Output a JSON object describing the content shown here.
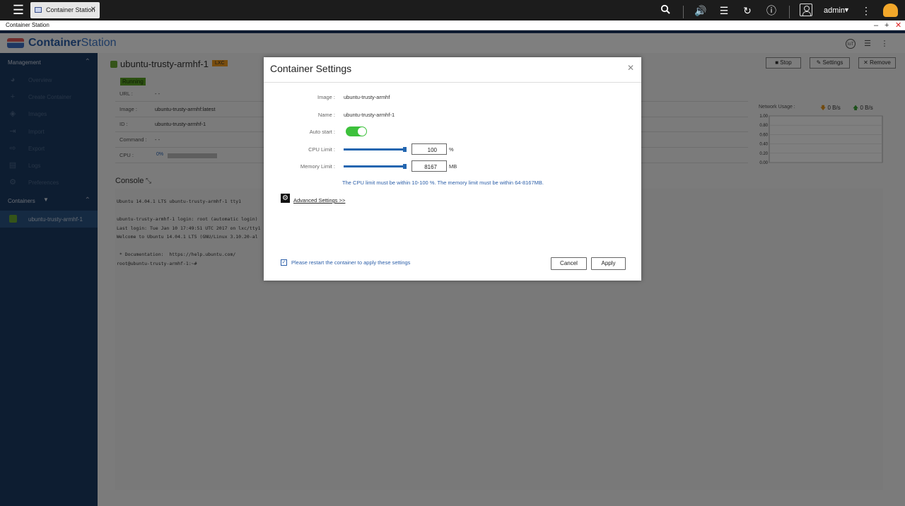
{
  "topbar": {
    "tab_label": "Container Station",
    "user": "admin"
  },
  "window": {
    "title": "Container Station"
  },
  "header": {
    "logo_bold": "Container",
    "logo_light": "Station"
  },
  "sidebar": {
    "management_label": "Management",
    "items": [
      {
        "label": "Overview",
        "icon": "gauge-icon"
      },
      {
        "label": "Create Container",
        "icon": "plus-icon"
      },
      {
        "label": "Images",
        "icon": "layers-icon"
      },
      {
        "label": "Import",
        "icon": "import-icon"
      },
      {
        "label": "Export",
        "icon": "export-icon"
      },
      {
        "label": "Logs",
        "icon": "logs-icon"
      },
      {
        "label": "Preferences",
        "icon": "gear-icon"
      }
    ],
    "containers_label": "Containers",
    "active_container": "ubuntu-trusty-armhf-1"
  },
  "container": {
    "name": "ubuntu-trusty-armhf-1",
    "type_badge": "LXC",
    "status": "Running",
    "details": [
      {
        "key": "URL :",
        "value": "- -"
      },
      {
        "key": "Image :",
        "value": "ubuntu-trusty-armhf:latest"
      },
      {
        "key": "ID :",
        "value": "ubuntu-trusty-armhf-1"
      },
      {
        "key": "Command :",
        "value": "- -"
      },
      {
        "key": "CPU :",
        "value": ""
      }
    ],
    "cpu_percent": "0%",
    "actions": {
      "stop": "Stop",
      "settings": "Settings",
      "remove": "Remove"
    }
  },
  "network": {
    "label": "Network Usage :",
    "download": "0 B/s",
    "upload": "0 B/s"
  },
  "chart_data": {
    "type": "line",
    "title": "",
    "ylim": [
      0,
      1
    ],
    "yticks": [
      "1.00",
      "0.80",
      "0.60",
      "0.40",
      "0.20",
      "0.00"
    ],
    "series": []
  },
  "console": {
    "title": "Console",
    "lines": [
      "Ubuntu 14.04.1 LTS ubuntu-trusty-armhf-1 tty1",
      "",
      "ubuntu-trusty-armhf-1 login: root (automatic login)",
      "Last login: Tue Jan 10 17:49:51 UTC 2017 on lxc/tty1",
      "Welcome to Ubuntu 14.04.1 LTS (GNU/Linux 3.10.20-al",
      "",
      " * Documentation:  https://help.ubuntu.com/",
      "root@ubuntu-trusty-armhf-1:~#"
    ]
  },
  "modal": {
    "title": "Container Settings",
    "image_label": "Image :",
    "image_value": "ubuntu-trusty-armhf",
    "name_label": "Name :",
    "name_value": "ubuntu-trusty-armhf-1",
    "autostart_label": "Auto start :",
    "autostart_on": true,
    "cpu_label": "CPU Limit :",
    "cpu_value": "100",
    "cpu_unit": "%",
    "mem_label": "Memory Limit :",
    "mem_value": "8167",
    "mem_unit": "MB",
    "limit_note": "The CPU limit must be within 10-100 %. The memory limit must be within 64-8167MB.",
    "advanced_link": "Advanced Settings >>",
    "restart_note": "Please restart the container to apply these settings",
    "restart_checked": true,
    "cancel": "Cancel",
    "apply": "Apply"
  }
}
